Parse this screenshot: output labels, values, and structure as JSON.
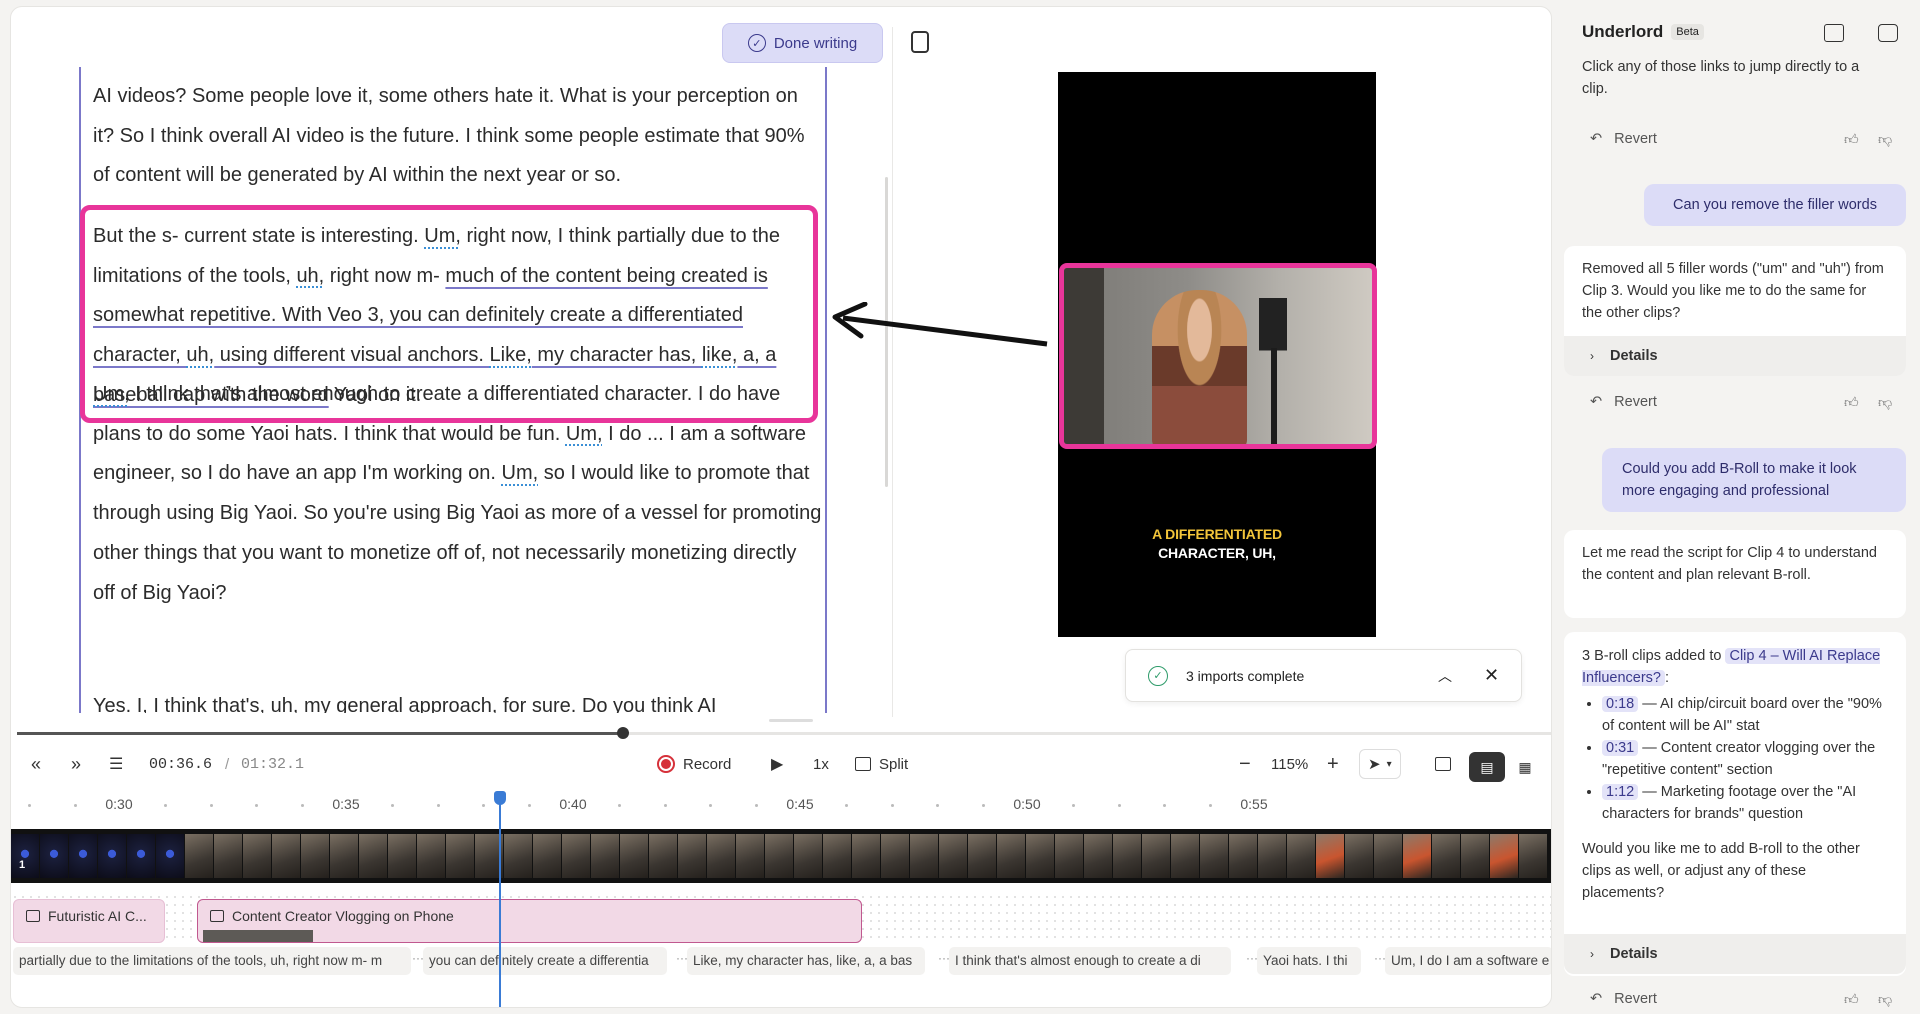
{
  "editor": {
    "done_label": "Done writing",
    "paragraphs": [
      [
        {
          "t": "AI videos? Some people love it, some others hate it. What is your perception on it? So I think overall AI video is the future. I think some people estimate that 90% of content will be generated by AI within the next year or so."
        }
      ],
      [
        {
          "t": "But the s- current state is interesting. "
        },
        {
          "t": "Um,",
          "f": 1
        },
        {
          "t": " right now, I think partially due to the limitations of the tools, "
        },
        {
          "t": "uh,",
          "f": 1
        },
        {
          "t": " right now m- "
        },
        {
          "t": "much of the content being created is somewhat repetitive. With Veo 3, you can definitely create a differentiated character, ",
          "b": 1
        },
        {
          "t": "uh,",
          "f": 1
        },
        {
          "t": " using different visual anchors. ",
          "b": 1
        },
        {
          "t": "Like,",
          "f": 1
        },
        {
          "t": " my character has, ",
          "b": 1
        },
        {
          "t": "like,",
          "f": 1
        },
        {
          "t": " a, a baseball cap with the word",
          "b": 1
        },
        {
          "t": " Yaoi on it."
        }
      ],
      [
        {
          "t": "Um,",
          "f": 1
        },
        {
          "t": " I think that's almost enough to create a differentiated character. I do have plans to do some Yaoi hats. I think that would be fun. "
        },
        {
          "t": "Um,",
          "f": 1
        },
        {
          "t": " I do ... I am a software engineer, so I do have an app I'm working on. "
        },
        {
          "t": "Um,",
          "f": 1
        },
        {
          "t": " so I would like to promote that through using Big Yaoi. So you're using Big Yaoi as more of a vessel for promoting other things that you want to monetize off of, not necessarily monetizing directly off of Big Yaoi?"
        }
      ],
      [
        {
          "t": "Yes. I, I think that's, uh, my general approach, for sure. Do you think AI"
        }
      ]
    ]
  },
  "preview": {
    "caption_highlight": "A DIFFERENTIATED",
    "caption_rest": "CHARACTER, UH,"
  },
  "toast": {
    "message": "3 imports complete"
  },
  "progress_fraction": 0.395,
  "controls": {
    "current_time": "00:36.6",
    "separator": "/",
    "total_time": "01:32.1",
    "record_label": "Record",
    "speed_label": "1x",
    "split_label": "Split",
    "zoom_label": "115%"
  },
  "timeline": {
    "ticks": [
      "0:30",
      "0:35",
      "0:40",
      "0:45",
      "0:50",
      "0:55"
    ],
    "clip_index": "1",
    "broll_clips": [
      "Futuristic AI C...",
      "Content Creator Vlogging on Phone"
    ],
    "transcript_segments": [
      "partially due to the limitations of the tools, uh, right now m- m",
      "you can definitely create a differentia",
      "Like, my character has, like, a, a bas",
      "I think that's almost enough to create a di",
      "Yaoi hats. I thi",
      "Um, I do I am a software e"
    ],
    "gap_marker": "···"
  },
  "sidebar": {
    "title": "Underlord",
    "badge": "Beta",
    "revert_label": "Revert",
    "details_label": "Details",
    "msg0": "Click any of those links to jump directly to a clip.",
    "user1": "Can you remove the filler words",
    "ai1": "Removed all 5 filler words (\"um\" and \"uh\") from Clip 3. Would you like me to do the same for the other clips?",
    "user2": "Could you add B-Roll to make it look more engaging and professional",
    "ai2": "Let me read the script for Clip 4 to understand the content and plan relevant B-roll.",
    "ai3_intro": "3 B-roll clips added to",
    "ai3_link": "Clip 4 – Will AI Replace Influencers?",
    "ai3_colon": ":",
    "ai3_items": [
      {
        "time": "0:18",
        "text": " — AI chip/circuit board over the \"90% of content will be AI\" stat"
      },
      {
        "time": "0:31",
        "text": " — Content creator vlogging over the \"repetitive content\" section"
      },
      {
        "time": "1:12",
        "text": " — Marketing footage over the \"AI characters for brands\" question"
      }
    ],
    "ai3_outro": "Would you like me to add B-roll to the other clips as well, or adjust any of these placements?"
  },
  "colors": {
    "accent": "#7b78c9",
    "highlight": "#e8359a",
    "playhead": "#3a7bd5",
    "caption_yellow": "#f3c53a"
  }
}
